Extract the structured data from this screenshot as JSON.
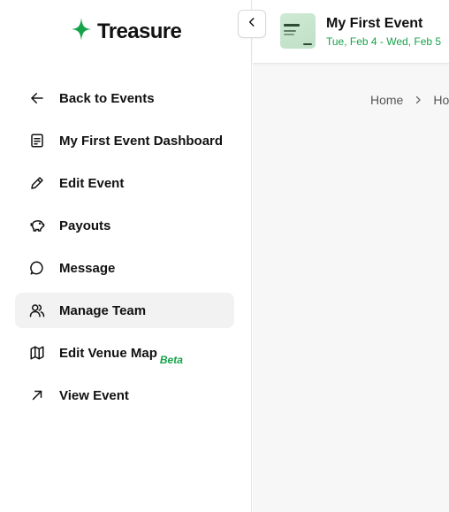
{
  "brand": {
    "name": "Treasure",
    "accent": "#16a34a"
  },
  "sidebar": {
    "items": [
      {
        "label": "Back to Events",
        "icon": "arrow-left-icon",
        "active": false
      },
      {
        "label": "My First Event Dashboard",
        "icon": "dashboard-icon",
        "active": false
      },
      {
        "label": "Edit Event",
        "icon": "pencil-icon",
        "active": false
      },
      {
        "label": "Payouts",
        "icon": "piggy-bank-icon",
        "active": false
      },
      {
        "label": "Message",
        "icon": "message-bubble-icon",
        "active": false
      },
      {
        "label": "Manage Team",
        "icon": "users-icon",
        "active": true
      },
      {
        "label": "Edit Venue Map",
        "icon": "map-icon",
        "active": false,
        "badge": "Beta"
      },
      {
        "label": "View Event",
        "icon": "arrow-up-right-icon",
        "active": false
      }
    ]
  },
  "header": {
    "event_title": "My First Event",
    "event_date": "Tue, Feb 4 - Wed, Feb 5"
  },
  "breadcrumb": {
    "items": [
      "Home",
      "Ho"
    ]
  }
}
